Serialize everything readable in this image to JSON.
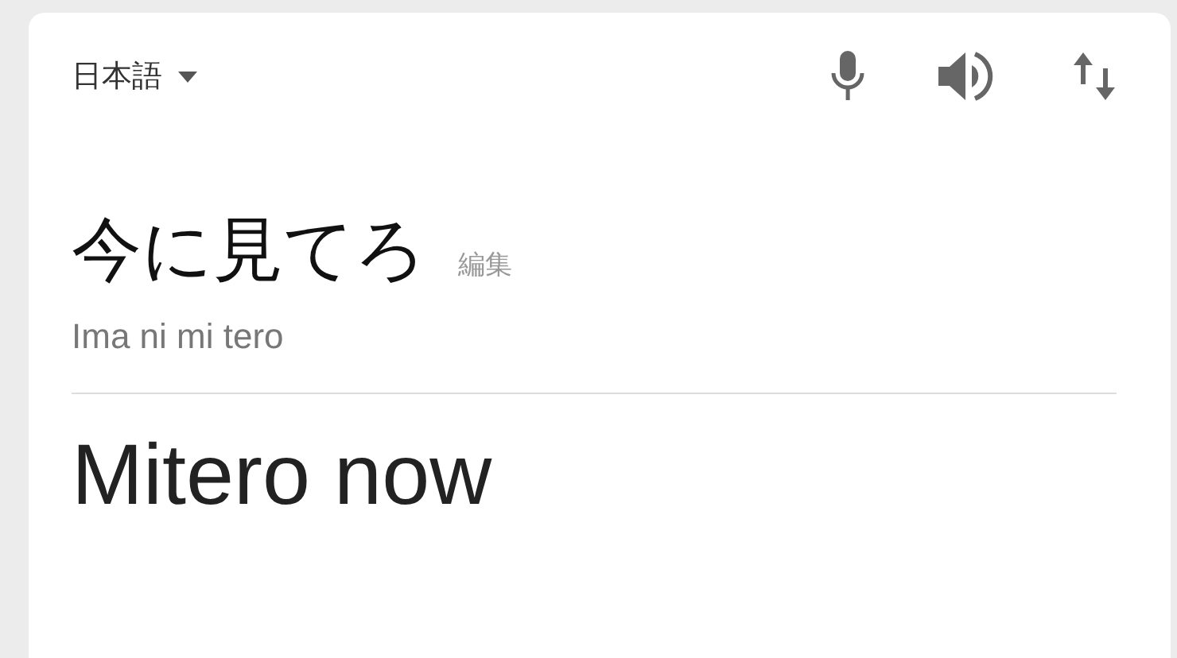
{
  "language_selector": {
    "label": "日本語"
  },
  "source": {
    "text": "今に見てろ",
    "edit_link": "編集",
    "romanization": "Ima ni mi tero"
  },
  "translation": {
    "text": "Mitero now"
  }
}
